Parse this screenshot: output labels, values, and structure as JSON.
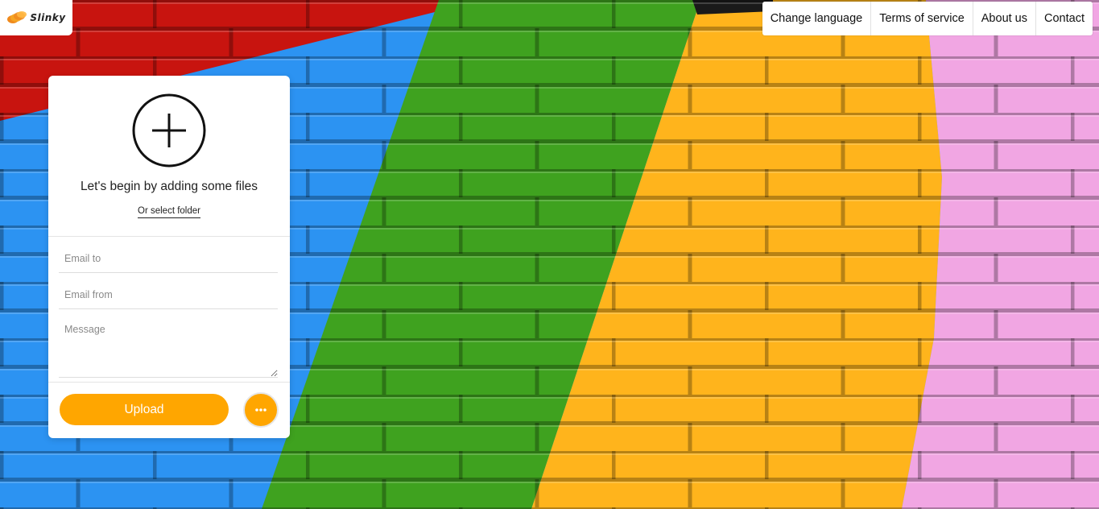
{
  "brand": {
    "name": "Slinky",
    "logo_icon": "slinky-logo-icon"
  },
  "nav": {
    "items": [
      {
        "label": "Change language"
      },
      {
        "label": "Terms of service"
      },
      {
        "label": "About us"
      },
      {
        "label": "Contact"
      }
    ]
  },
  "uploader": {
    "add_icon": "plus-circle-icon",
    "add_title": "Let's begin by adding some files",
    "select_folder": "Or select folder",
    "email_to_placeholder": "Email to",
    "email_from_placeholder": "Email from",
    "message_placeholder": "Message",
    "upload_label": "Upload",
    "more_icon": "more-options-icon"
  },
  "colors": {
    "accent": "#ffa600",
    "panel_bg": "#ffffff",
    "wall_red": "#c8140f",
    "wall_blue": "#2c93f2",
    "wall_green": "#3fa21f",
    "wall_yellow": "#ffb41c",
    "wall_pink": "#f1a6e3"
  }
}
